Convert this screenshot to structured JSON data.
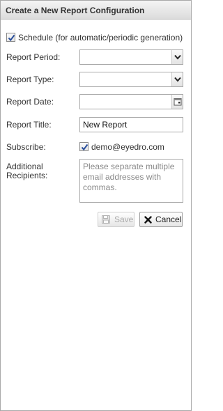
{
  "dialog": {
    "title": "Create a New Report Configuration"
  },
  "schedule": {
    "checked": true,
    "label": "Schedule (for automatic/periodic generation)"
  },
  "report_period": {
    "label": "Report Period:",
    "value": ""
  },
  "report_type": {
    "label": "Report Type:",
    "value": ""
  },
  "report_date": {
    "label": "Report Date:",
    "value": ""
  },
  "report_title": {
    "label": "Report Title:",
    "value": "New Report"
  },
  "subscribe": {
    "label": "Subscribe:",
    "checked": true,
    "email": "demo@eyedro.com"
  },
  "additional_recipients": {
    "label_line1": "Additional",
    "label_line2": "Recipients:",
    "placeholder": "Please separate multiple email addresses with commas."
  },
  "buttons": {
    "save_label": "Save",
    "save_enabled": false,
    "cancel_label": "Cancel"
  },
  "icons": {
    "checkmark": "checkmark-icon",
    "dropdown": "chevron-down-icon",
    "calendar": "calendar-icon",
    "save": "floppy-disk-icon",
    "cancel": "x-icon"
  }
}
